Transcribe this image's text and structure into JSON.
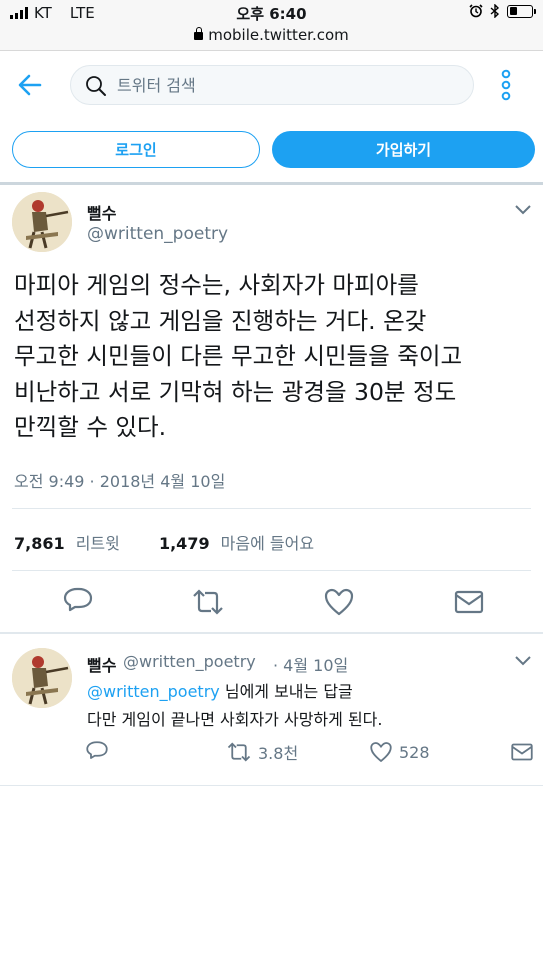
{
  "status_bar": {
    "carrier": "KT",
    "network": "LTE",
    "time": "오후 6:40",
    "battery_level": 0.3
  },
  "browser": {
    "url": "mobile.twitter.com"
  },
  "header": {
    "search_placeholder": "트위터 검색",
    "login_label": "로그인",
    "signup_label": "가입하기"
  },
  "tweet": {
    "display_name": "뻘수",
    "handle": "@written_poetry",
    "text": "마피아 게임의 정수는, 사회자가 마피아를\n선정하지 않고 게임을 진행하는 거다. 온갖\n무고한 시민들이 다른 무고한 시민들을 죽이고\n비난하고 서로 기막혀 하는 광경을 30분 정도\n만끽할 수 있다.",
    "timestamp": "오전 9:49 · 2018년 4월 10일",
    "retweets_count": "7,861",
    "retweets_label": "리트윗",
    "likes_count": "1,479",
    "likes_label": "마음에 들어요"
  },
  "reply": {
    "display_name": "뻘수",
    "handle": "@written_poetry",
    "date": "· 4월 10일",
    "replying_mention": "@written_poetry",
    "replying_suffix": "님에게 보내는 답글",
    "text": "다만 게임이 끝나면 사회자가 사망하게 된다.",
    "retweets": "3.8천",
    "likes": "528"
  },
  "colors": {
    "accent": "#1da1f2",
    "muted": "#657786",
    "border": "#e1e8ed"
  },
  "icons": [
    "back-arrow-icon",
    "search-icon",
    "more-options-icon",
    "caret-down-icon",
    "reply-icon",
    "retweet-icon",
    "like-icon",
    "message-icon",
    "lock-icon",
    "alarm-icon",
    "bluetooth-icon",
    "battery-icon",
    "signal-icon"
  ]
}
